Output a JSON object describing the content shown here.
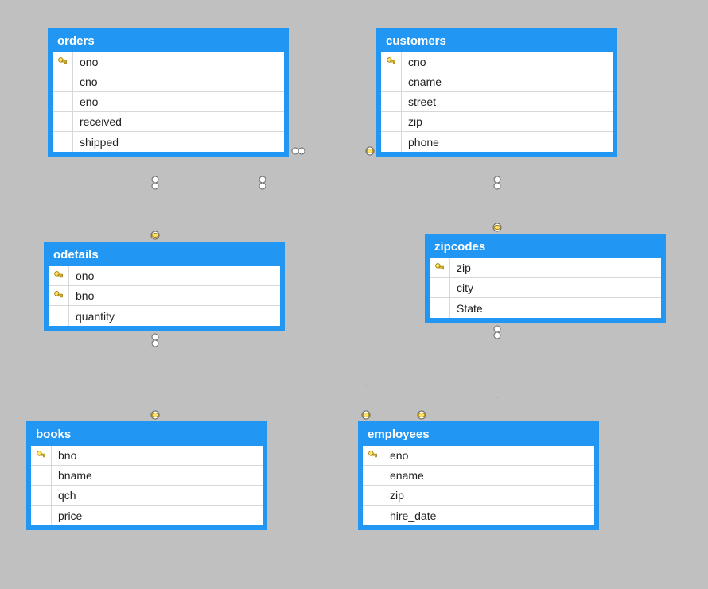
{
  "entities": {
    "orders": {
      "title": "orders",
      "cols": [
        {
          "name": "ono",
          "pk": true
        },
        {
          "name": "cno",
          "pk": false
        },
        {
          "name": "eno",
          "pk": false
        },
        {
          "name": "received",
          "pk": false
        },
        {
          "name": "shipped",
          "pk": false
        }
      ]
    },
    "customers": {
      "title": "customers",
      "cols": [
        {
          "name": "cno",
          "pk": true
        },
        {
          "name": "cname",
          "pk": false
        },
        {
          "name": "street",
          "pk": false
        },
        {
          "name": "zip",
          "pk": false
        },
        {
          "name": "phone",
          "pk": false
        }
      ]
    },
    "odetails": {
      "title": "odetails",
      "cols": [
        {
          "name": "ono",
          "pk": true
        },
        {
          "name": "bno",
          "pk": true
        },
        {
          "name": "quantity",
          "pk": false
        }
      ]
    },
    "zipcodes": {
      "title": "zipcodes",
      "cols": [
        {
          "name": "zip",
          "pk": true
        },
        {
          "name": "city",
          "pk": false
        },
        {
          "name": "State",
          "pk": false
        }
      ]
    },
    "books": {
      "title": "books",
      "cols": [
        {
          "name": "bno",
          "pk": true
        },
        {
          "name": "bname",
          "pk": false
        },
        {
          "name": "qch",
          "pk": false
        },
        {
          "name": "price",
          "pk": false
        }
      ]
    },
    "employees": {
      "title": "employees",
      "cols": [
        {
          "name": "eno",
          "pk": true
        },
        {
          "name": "ename",
          "pk": false
        },
        {
          "name": "zip",
          "pk": false
        },
        {
          "name": "hire_date",
          "pk": false
        }
      ]
    }
  },
  "relationships": [
    {
      "from": "orders",
      "to": "customers"
    },
    {
      "from": "orders",
      "to": "odetails"
    },
    {
      "from": "orders",
      "to": "employees"
    },
    {
      "from": "customers",
      "to": "zipcodes"
    },
    {
      "from": "odetails",
      "to": "books"
    },
    {
      "from": "zipcodes",
      "to": "employees"
    }
  ]
}
